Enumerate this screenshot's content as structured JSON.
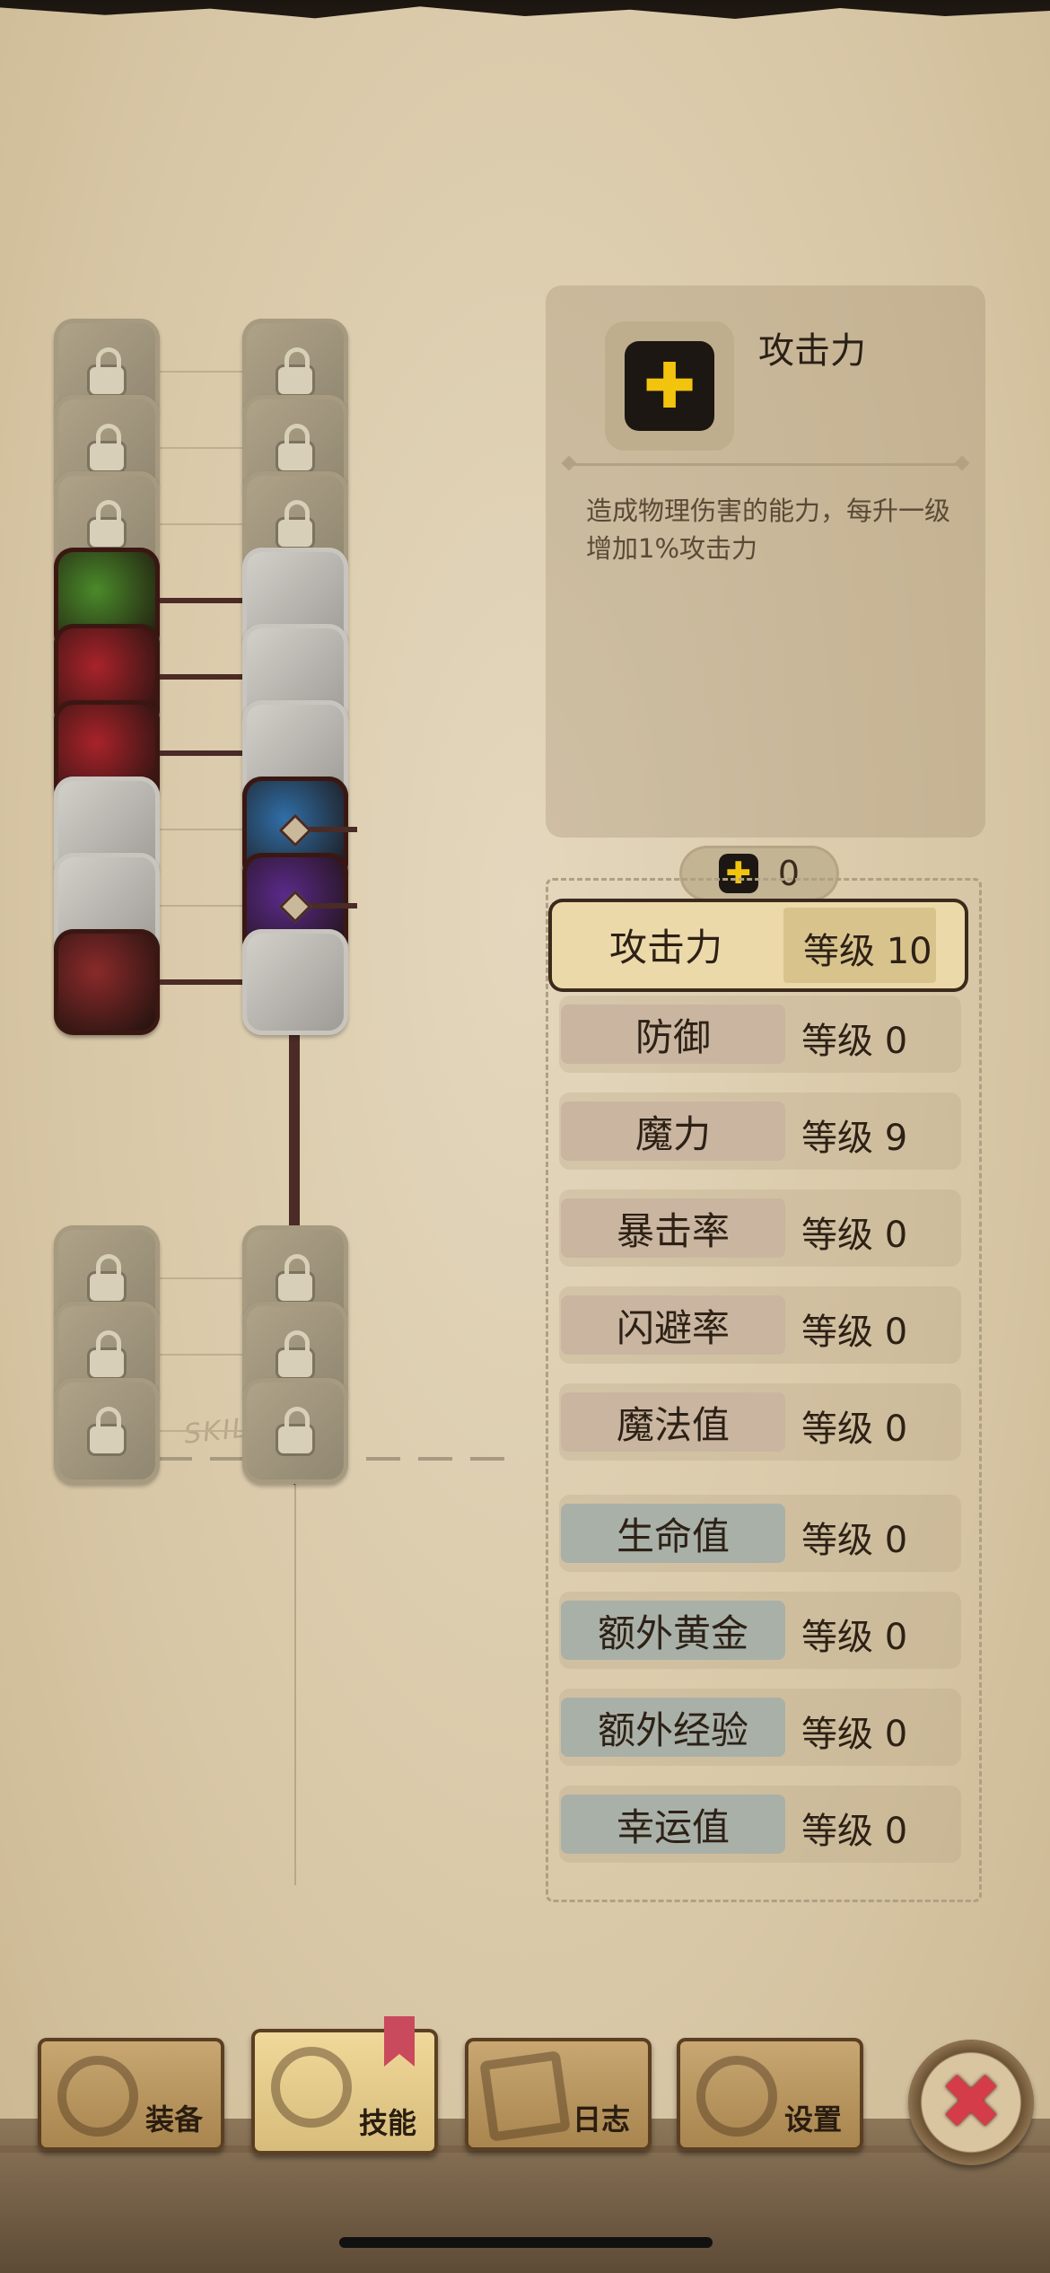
{
  "skill_tree": {
    "label": "SKILL",
    "left_column": [
      {
        "state": "locked"
      },
      {
        "state": "locked"
      },
      {
        "state": "locked"
      },
      {
        "state": "unlocked",
        "color": "#4a8a2a"
      },
      {
        "state": "unlocked",
        "color": "#a8232a"
      },
      {
        "state": "unlocked",
        "color": "#a8232a"
      },
      {
        "state": "inactive"
      },
      {
        "state": "inactive"
      },
      {
        "state": "unlocked",
        "color": "#8a2a2a"
      },
      {
        "state": "locked"
      },
      {
        "state": "locked"
      },
      {
        "state": "locked"
      }
    ],
    "right_column": [
      {
        "state": "locked"
      },
      {
        "state": "locked"
      },
      {
        "state": "locked"
      },
      {
        "state": "inactive"
      },
      {
        "state": "inactive"
      },
      {
        "state": "inactive"
      },
      {
        "state": "unlocked",
        "color": "#2f6fa8"
      },
      {
        "state": "unlocked",
        "color": "#5a2a8a"
      },
      {
        "state": "inactive"
      },
      {
        "state": "locked"
      },
      {
        "state": "locked"
      },
      {
        "state": "locked"
      }
    ]
  },
  "detail": {
    "title": "攻击力",
    "description": "造成物理伤害的能力，每升一级增加1%攻击力",
    "icon": "plus-icon"
  },
  "points": {
    "value": "0",
    "icon": "plus-icon"
  },
  "stats": [
    {
      "name": "攻击力",
      "level": "等级 10",
      "selected": true,
      "tone": "warm"
    },
    {
      "name": "防御",
      "level": "等级 0",
      "tone": "warm"
    },
    {
      "name": "魔力",
      "level": "等级 9",
      "tone": "warm"
    },
    {
      "name": "暴击率",
      "level": "等级 0",
      "tone": "warm"
    },
    {
      "name": "闪避率",
      "level": "等级 0",
      "tone": "warm"
    },
    {
      "name": "魔法值",
      "level": "等级 0",
      "tone": "warm"
    },
    {
      "name": "生命值",
      "level": "等级 0",
      "tone": "cool"
    },
    {
      "name": "额外黄金",
      "level": "等级 0",
      "tone": "cool"
    },
    {
      "name": "额外经验",
      "level": "等级 0",
      "tone": "cool"
    },
    {
      "name": "幸运值",
      "level": "等级 0",
      "tone": "cool"
    }
  ],
  "nav": [
    {
      "label": "装备",
      "icon": "axe-icon"
    },
    {
      "label": "技能",
      "icon": "skill-ring-icon",
      "active": true
    },
    {
      "label": "日志",
      "icon": "journal-icon"
    },
    {
      "label": "设置",
      "icon": "gear-icon"
    }
  ],
  "close_icon": "close-icon",
  "colors": {
    "accent_yellow": "#f2c40d",
    "close_red": "#d43c4a",
    "tree_line": "#4a2b25"
  }
}
